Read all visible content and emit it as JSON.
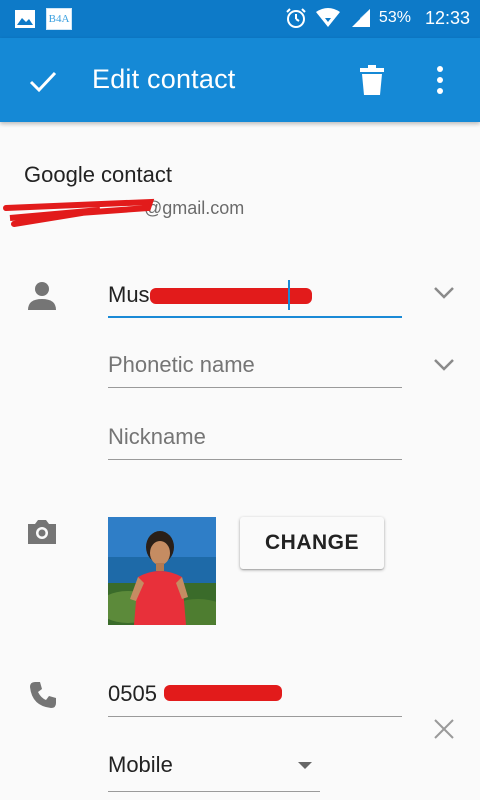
{
  "status_bar": {
    "b4a_label": "B4A",
    "battery": "53%",
    "time": "12:33"
  },
  "toolbar": {
    "title": "Edit contact",
    "icons": {
      "save": "check-icon",
      "delete": "trash-icon",
      "more": "more-vert-icon"
    }
  },
  "account": {
    "title": "Google contact",
    "email_suffix": "@gmail.com"
  },
  "name_section": {
    "icon": "person-icon",
    "name_value": "Mus",
    "phonetic_placeholder": "Phonetic name",
    "nickname_placeholder": "Nickname"
  },
  "photo_section": {
    "icon": "camera-icon",
    "change_label": "CHANGE"
  },
  "phone_section": {
    "icon": "phone-icon",
    "number_value": "0505",
    "type_value": "Mobile"
  },
  "colors": {
    "status_bar": "#0d7ac8",
    "toolbar": "#1589d6",
    "accent": "#1a8ad6",
    "redaction": "#e21b1b"
  }
}
